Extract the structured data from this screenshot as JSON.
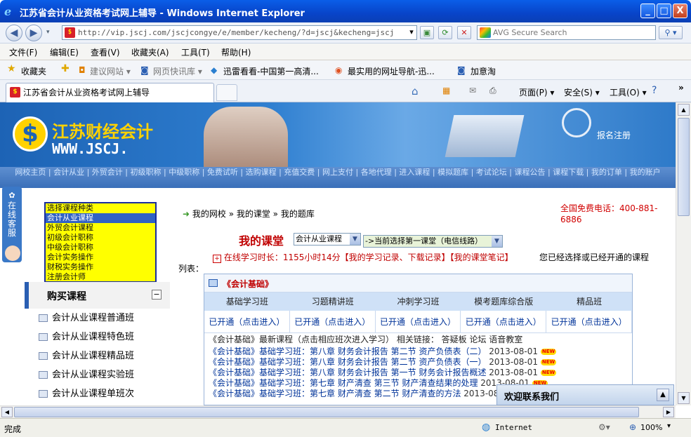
{
  "window": {
    "title": "江苏省会计从业资格考试网上辅导 - Windows Internet Explorer",
    "min": "_",
    "max": "□",
    "close": "X"
  },
  "address": {
    "url": "http://vip.jscj.com/jscjcongye/e/member/kecheng/?d=jscj&kecheng=jscj",
    "search_placeholder": "AVG Secure Search"
  },
  "menu": [
    "文件(F)",
    "编辑(E)",
    "查看(V)",
    "收藏夹(A)",
    "工具(T)",
    "帮助(H)"
  ],
  "favorites": {
    "label": "收藏夹",
    "items": [
      "建议网站 ▾",
      "网页快讯库 ▾",
      "迅雷看看-中国第一高清...",
      "最实用的网址导航-迅...",
      "加意淘"
    ]
  },
  "tab": {
    "title": "江苏省会计从业资格考试网上辅导",
    "tools": [
      "页面(P) ▾",
      "安全(S) ▾",
      "工具(O) ▾"
    ]
  },
  "site": {
    "logo_cn": "江苏财经会计",
    "logo_en": "WWW.JSCJ.",
    "register": "报名注册",
    "nav": "网校主页 | 会计从业 | 外贸会计 | 初级职称 | 中级职称 | 免费试听 | 选购课程 | 充值交费 | 网上支付 | 各地代理 | 进入课程 | 模拟题库 | 考试论坛 | 课程公告 | 课程下载 | 我的订单 | 我的账户",
    "qq": "在线客服"
  },
  "course_select": {
    "options": [
      "选择课程种类",
      "会计从业课程",
      "外贸会计课程",
      "初级会计职称",
      "中级会计职称",
      "会计实务操作",
      "财税实务操作",
      "注册会计师"
    ],
    "selected_index": 1
  },
  "buy": {
    "title": "购买课程",
    "toggle": "−",
    "items": [
      "会计从业课程普通班",
      "会计从业课程特色班",
      "会计从业课程精品班",
      "会计从业课程实验班",
      "会计从业课程单班次"
    ]
  },
  "breadcrumb": "我的网校 » 我的课堂 » 我的题库",
  "phone": "全国免费电话：400-881-6886",
  "classroom": {
    "title": "我的课堂",
    "course_dd": "会计从业课程",
    "line_dd": "->当前选择第一课堂（电信线路）",
    "stats": "在线学习时长：1155小时14分【我的学习记录、下载记录】【我的课堂笔记】",
    "hint": "您已经选择或已经开通的课程",
    "list_label": "列表："
  },
  "panel": {
    "title": "《会计基础》",
    "headers": [
      "基础学习班",
      "习题精讲班",
      "冲刺学习班",
      "模考题库综合版",
      "精品班"
    ],
    "row": [
      "已开通（点击进入）",
      "已开通（点击进入）",
      "已开通（点击进入）",
      "已开通（点击进入）",
      "已开通（点击进入）"
    ],
    "intro": "《会计基础》最新课程（点击相应班次进入学习） 相关链接： 答疑板 论坛 语音教室",
    "news": [
      {
        "text": "《会计基础》基础学习班：第八章 财务会计报告 第二节 资产负债表（二）",
        "date": "2013-08-01"
      },
      {
        "text": "《会计基础》基础学习班：第八章 财务会计报告 第二节 资产负债表（一）",
        "date": "2013-08-01"
      },
      {
        "text": "《会计基础》基础学习班：第八章 财务会计报告 第一节 财务会计报告概述",
        "date": "2013-08-01"
      },
      {
        "text": "《会计基础》基础学习班：第七章 财产清查 第三节 财产清查结果的处理",
        "date": "2013-08-01"
      },
      {
        "text": "《会计基础》基础学习班：第七章 财产清查 第二节 财产清查的方法",
        "date": "2013-08-01"
      }
    ],
    "new_badge": "NEW"
  },
  "contact": {
    "title": "欢迎联系我们",
    "toggle": "▲"
  },
  "status": {
    "left": "完成",
    "zone": "Internet",
    "zoom": "100%"
  },
  "colors": {
    "titlebar": "#0844c9",
    "accent_red": "#c00000",
    "link_blue": "#003399",
    "select_yellow": "#ffff00"
  }
}
